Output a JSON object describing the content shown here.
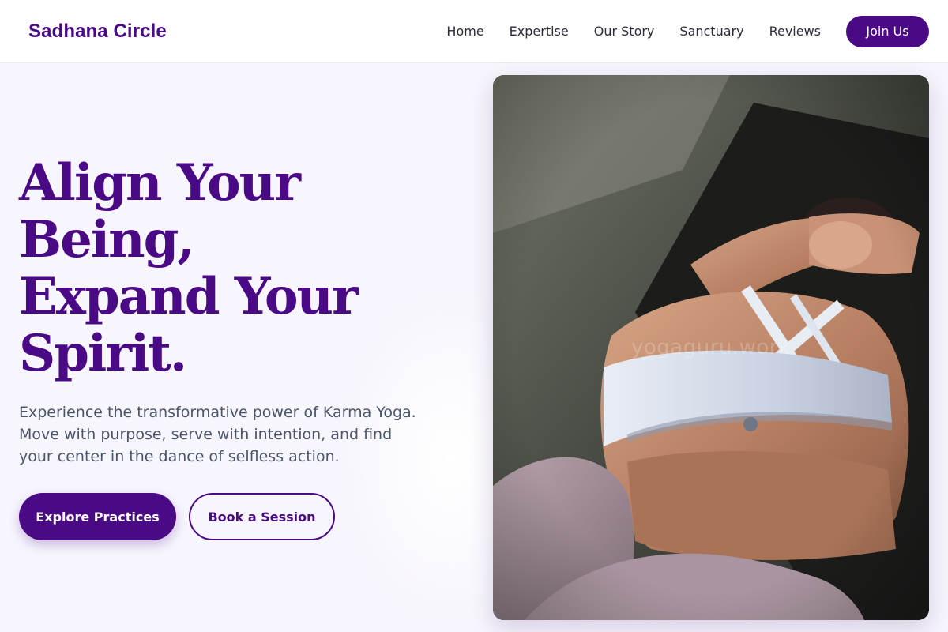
{
  "brand": {
    "name": "Sadhana Circle"
  },
  "nav": {
    "items": [
      "Home",
      "Expertise",
      "Our Story",
      "Sanctuary",
      "Reviews"
    ],
    "cta": "Join Us"
  },
  "hero": {
    "headline_lines": [
      "Align Your",
      "Being,",
      "Expand Your",
      "Spirit."
    ],
    "subtext": "Experience the transformative power of Karma Yoga. Move with purpose, serve with intention, and find your center in the dance of selfless action.",
    "primary_button": "Explore Practices",
    "secondary_button": "Book a Session",
    "image": {
      "subject": "woman in white sports bra stretching on a dark yoga mat",
      "watermark": "yogaguru.work"
    }
  },
  "colors": {
    "brand_purple": "#4b0a85",
    "page_background": "#f7f5fd",
    "text_muted": "#4a5568",
    "nav_text": "#2d2a3a"
  }
}
